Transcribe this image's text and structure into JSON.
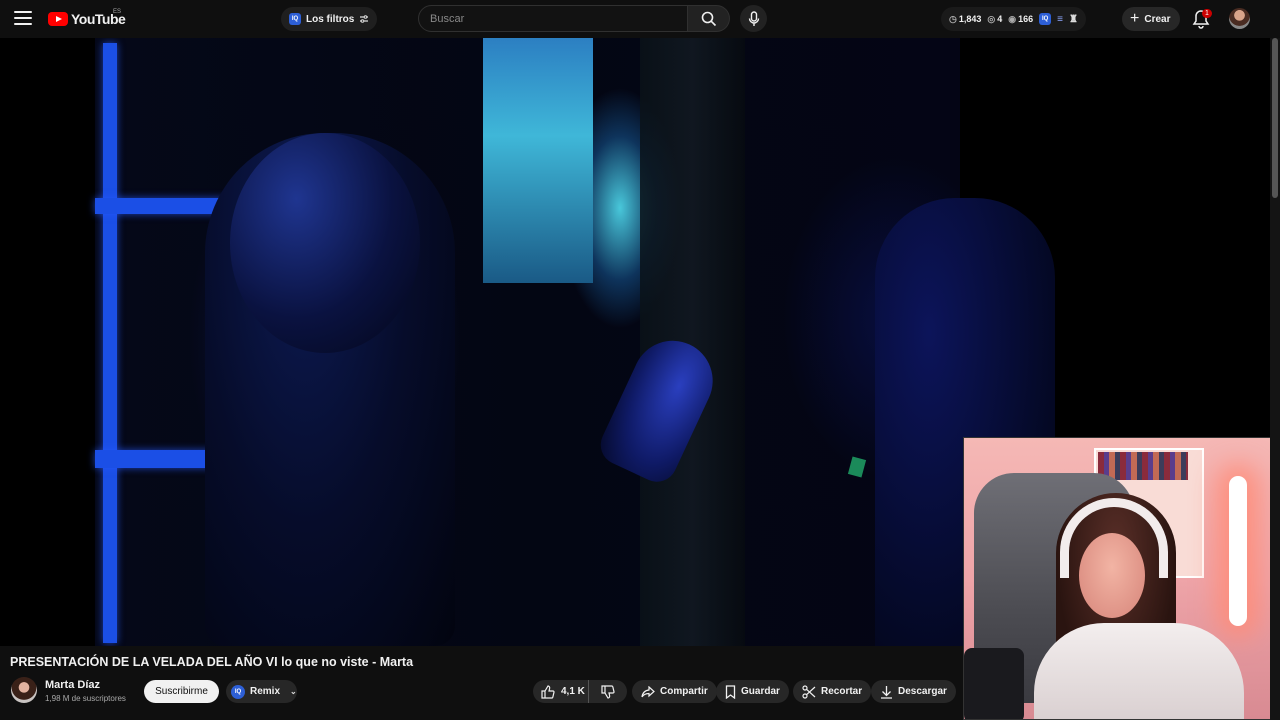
{
  "header": {
    "logo_text": "YouTube",
    "region": "ES",
    "filters_label": "Los filtros",
    "iq_label": "IQ",
    "search_placeholder": "Buscar",
    "stats": {
      "time": "1,843",
      "views": "4",
      "eye": "166"
    },
    "create_label": "Crear",
    "notification_count": "1"
  },
  "video": {
    "title": "PRESENTACIÓN DE LA VELADA DEL AÑO VI lo que no viste - Marta"
  },
  "channel": {
    "name": "Marta Díaz",
    "subscribers": "1,98 M de suscriptores",
    "subscribe_label": "Suscribirme",
    "remix_label": "Remix"
  },
  "actions": {
    "likes": "4,1 K",
    "share_label": "Compartir",
    "save_label": "Guardar",
    "clip_label": "Recortar",
    "download_label": "Descargar"
  },
  "colors": {
    "brand": "#ff0000",
    "background": "#0f0f0f",
    "pill": "#272727",
    "iq_blue": "#2d5fd6"
  }
}
